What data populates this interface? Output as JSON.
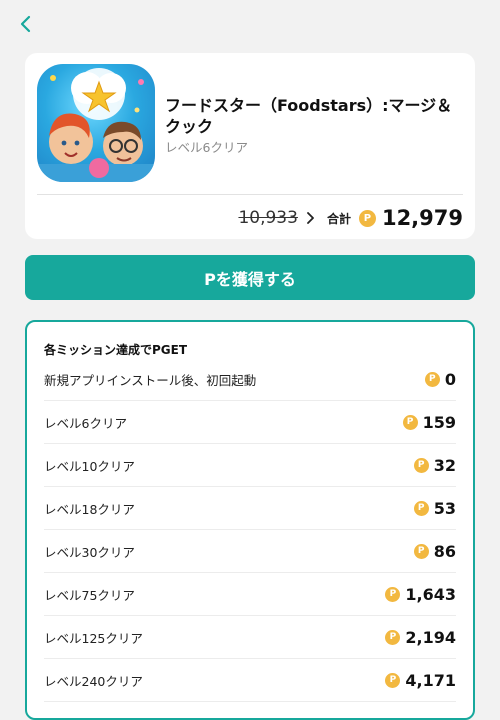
{
  "nav": {
    "back_icon": "chevron-left-icon",
    "accent": "#17a89c"
  },
  "app": {
    "title": "フードスター（Foodstars）:マージ＆クック",
    "subtitle": "レベル6クリア",
    "old_price": "10,933",
    "total_label": "合計",
    "total_price": "12,979",
    "coin_glyph": "P"
  },
  "cta": {
    "label": "Pを獲得する",
    "color": "#17a89c"
  },
  "missions": {
    "header": "各ミッション達成でPGET",
    "items": [
      {
        "label": "新規アプリインストール後、初回起動",
        "points": "0"
      },
      {
        "label": "レベル6クリア",
        "points": "159"
      },
      {
        "label": "レベル10クリア",
        "points": "32"
      },
      {
        "label": "レベル18クリア",
        "points": "53"
      },
      {
        "label": "レベル30クリア",
        "points": "86"
      },
      {
        "label": "レベル75クリア",
        "points": "1,643"
      },
      {
        "label": "レベル125クリア",
        "points": "2,194"
      },
      {
        "label": "レベル240クリア",
        "points": "4,171"
      }
    ]
  }
}
